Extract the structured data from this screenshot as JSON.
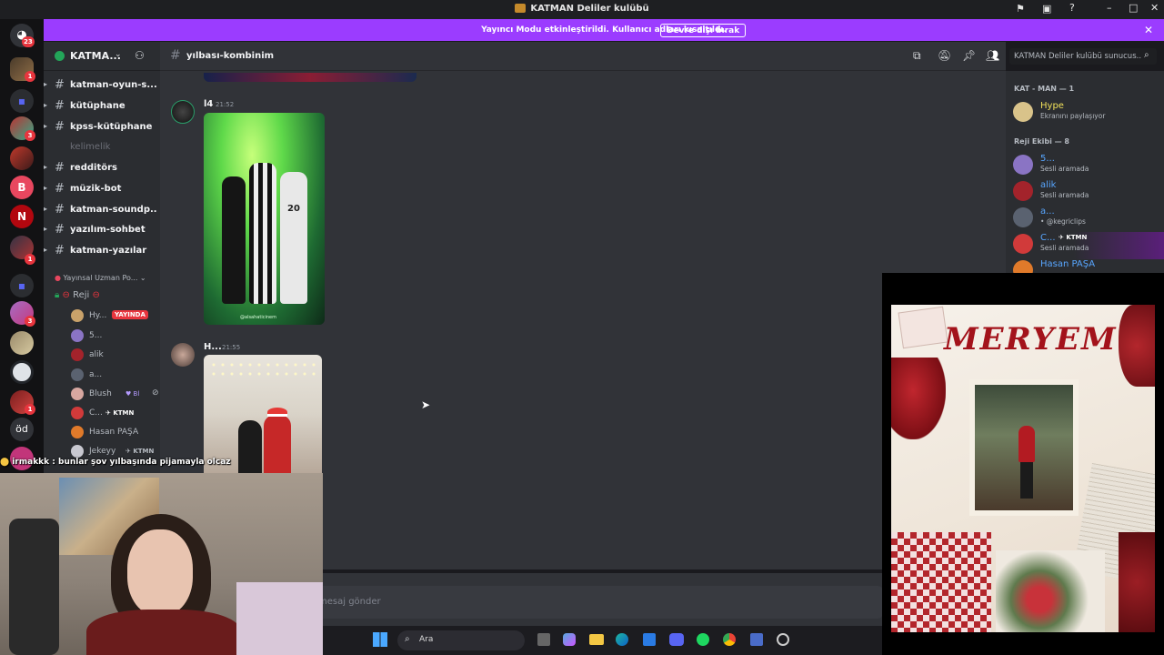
{
  "window": {
    "title": "KATMAN Deliler kulübü"
  },
  "banner": {
    "text": "Yayıncı Modu etkinleştirildi. Kullanıcı adları kısaltıldı.",
    "button": "Devre dışı bırak"
  },
  "servers": {
    "dm_badge": "23",
    "badges": [
      "1",
      "3",
      "1",
      "3",
      "1",
      "2"
    ],
    "od_label": "öd"
  },
  "server": {
    "name": "KATMA..."
  },
  "channels": [
    {
      "name": "katman-oyun-s..."
    },
    {
      "name": "kütüphane"
    },
    {
      "name": "kpss-kütüphane"
    },
    {
      "name": "kelimelik"
    },
    {
      "name": "redditörs"
    },
    {
      "name": "müzik-bot"
    },
    {
      "name": "katman-soundp..."
    },
    {
      "name": "yazılım-sohbet"
    },
    {
      "name": "katman-yazılar"
    }
  ],
  "category": {
    "name": "Yayınsal Uzman Po..."
  },
  "voice": {
    "channel": "Reji",
    "live_badge": "YAYINDA",
    "users": [
      "Hy...",
      "5...",
      "alik",
      "a...",
      "Blush",
      "C...",
      "Hasan PAŞA",
      "Jekeyy"
    ],
    "tags": {
      "blush": "Bl",
      "c": "KTMN",
      "jekeyy": "KTMN"
    }
  },
  "header": {
    "channel": "yılbası-kombinim",
    "search_placeholder": "KATMAN Deliler kulübü sunucus..."
  },
  "messages": [
    {
      "author": "l4",
      "time": "21:52"
    },
    {
      "author": "H...",
      "time": "21:55"
    }
  ],
  "photo_texts": {
    "l4_caption": "@alsahaticinem",
    "jersey_no": "20"
  },
  "composer": {
    "placeholder": "mesaj gönder"
  },
  "members": {
    "group1": "KAT - MAN — 1",
    "group2": "Reji Ekibi — 8",
    "list1": [
      {
        "name": "Hype",
        "status": "Ekranını paylaşıyor"
      }
    ],
    "list2": [
      {
        "name": "5...",
        "status": "Sesli aramada"
      },
      {
        "name": "alik",
        "status": "Sesli aramada"
      },
      {
        "name": "a...",
        "status": "• @kegriclips"
      },
      {
        "name": "C...",
        "tag": "KTMN",
        "status": "Sesli aramada"
      },
      {
        "name": "Hasan PAŞA",
        "status": ""
      }
    ]
  },
  "chat_overlay": {
    "text": "irmakkk : bunlar şov yılbaşında pijamayla olcaz"
  },
  "taskbar": {
    "search": "Ara"
  },
  "overlay": {
    "title": "MERYEM"
  },
  "colors": {
    "banner": "#9b3cff",
    "live": "#e8353e",
    "blurple": "#5865f2"
  }
}
